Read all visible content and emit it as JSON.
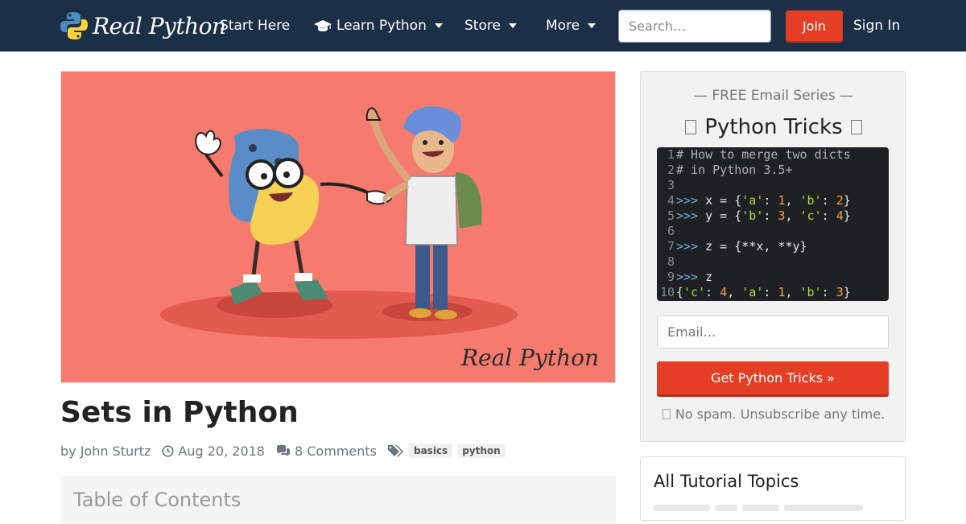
{
  "nav": {
    "brand": "Real Python",
    "items": [
      "Start Here",
      "Learn Python",
      "Store",
      "More"
    ],
    "search_placeholder": "Search…",
    "join": "Join",
    "signin": "Sign In"
  },
  "hero": {
    "watermark": "Real Python",
    "background": "#f67b6e"
  },
  "article": {
    "title": "Sets in Python",
    "author": "by John Sturtz",
    "date": "Aug 20, 2018",
    "comments": "8 Comments",
    "tags": [
      "basics",
      "python"
    ],
    "toc_title": "Table of Contents"
  },
  "sidebar": {
    "series": "— FREE Email Series —",
    "headline": "Python Tricks",
    "code_lines": [
      {
        "n": "1",
        "parts": [
          {
            "t": "# How to merge two dicts",
            "c": "cm"
          }
        ]
      },
      {
        "n": "2",
        "parts": [
          {
            "t": "# in Python 3.5+",
            "c": "cm"
          }
        ]
      },
      {
        "n": "3",
        "parts": []
      },
      {
        "n": "4",
        "parts": [
          {
            "t": ">>> ",
            "c": "pr"
          },
          {
            "t": "x = {",
            "c": "cl"
          },
          {
            "t": "'a'",
            "c": "st"
          },
          {
            "t": ": ",
            "c": "cl"
          },
          {
            "t": "1",
            "c": "nu"
          },
          {
            "t": ", ",
            "c": "cl"
          },
          {
            "t": "'b'",
            "c": "st"
          },
          {
            "t": ": ",
            "c": "cl"
          },
          {
            "t": "2",
            "c": "nu"
          },
          {
            "t": "}",
            "c": "cl"
          }
        ]
      },
      {
        "n": "5",
        "parts": [
          {
            "t": ">>> ",
            "c": "pr"
          },
          {
            "t": "y = {",
            "c": "cl"
          },
          {
            "t": "'b'",
            "c": "st"
          },
          {
            "t": ": ",
            "c": "cl"
          },
          {
            "t": "3",
            "c": "nu"
          },
          {
            "t": ", ",
            "c": "cl"
          },
          {
            "t": "'c'",
            "c": "st"
          },
          {
            "t": ": ",
            "c": "cl"
          },
          {
            "t": "4",
            "c": "nu"
          },
          {
            "t": "}",
            "c": "cl"
          }
        ]
      },
      {
        "n": "6",
        "parts": []
      },
      {
        "n": "7",
        "parts": [
          {
            "t": ">>> ",
            "c": "pr"
          },
          {
            "t": "z = {**x, **y}",
            "c": "cl"
          }
        ]
      },
      {
        "n": "8",
        "parts": []
      },
      {
        "n": "9",
        "parts": [
          {
            "t": ">>> ",
            "c": "pr"
          },
          {
            "t": "z",
            "c": "cl"
          }
        ]
      },
      {
        "n": "10",
        "parts": [
          {
            "t": "{",
            "c": "cl"
          },
          {
            "t": "'c'",
            "c": "st"
          },
          {
            "t": ": ",
            "c": "cl"
          },
          {
            "t": "4",
            "c": "nu"
          },
          {
            "t": ", ",
            "c": "cl"
          },
          {
            "t": "'a'",
            "c": "st"
          },
          {
            "t": ": ",
            "c": "cl"
          },
          {
            "t": "1",
            "c": "nu"
          },
          {
            "t": ", ",
            "c": "cl"
          },
          {
            "t": "'b'",
            "c": "st"
          },
          {
            "t": ": ",
            "c": "cl"
          },
          {
            "t": "3",
            "c": "nu"
          },
          {
            "t": "}",
            "c": "cl"
          }
        ]
      }
    ],
    "email_placeholder": "Email…",
    "cta": "Get Python Tricks »",
    "nospam": "No spam. Unsubscribe any time.",
    "topics_title": "All Tutorial Topics"
  },
  "colors": {
    "navbar": "#1b3047",
    "accent": "#e43f25"
  }
}
